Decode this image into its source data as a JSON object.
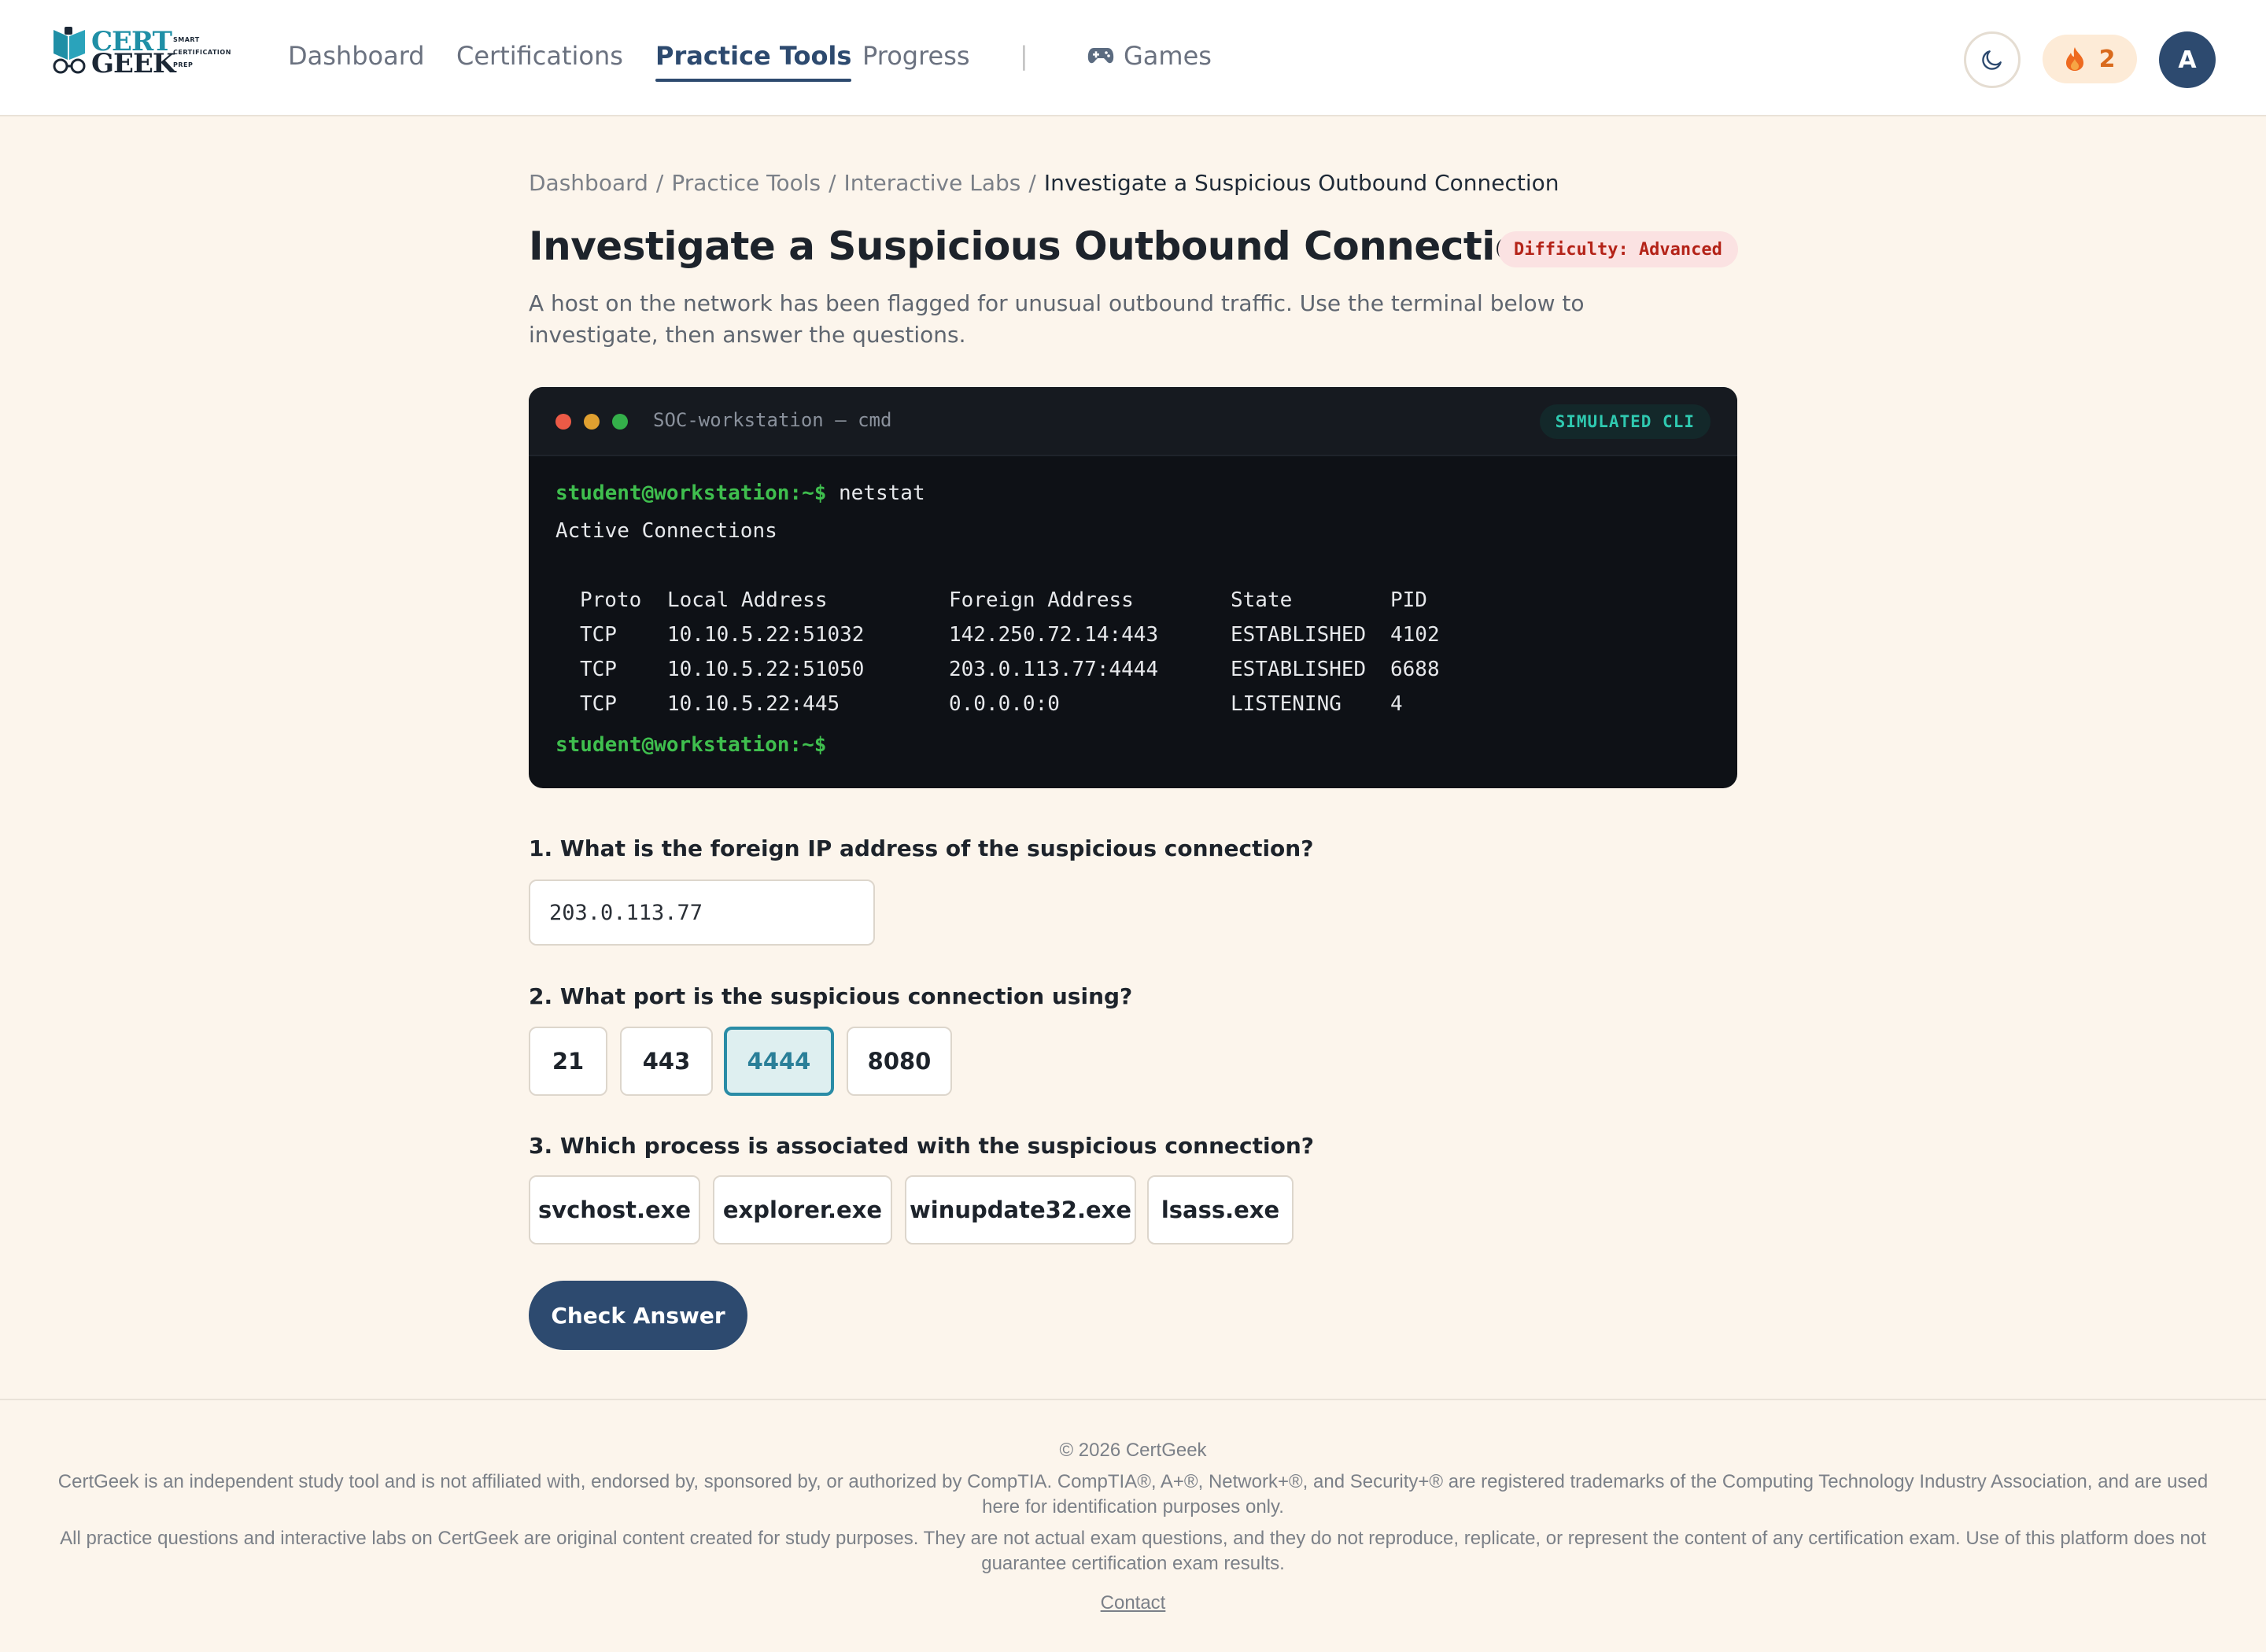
{
  "brand": {
    "word1": "CERT",
    "word2": "GEEK",
    "tag1": "SMART",
    "tag2": "CERTIFICATION",
    "tag3": "PREP"
  },
  "nav": {
    "items": [
      {
        "label": "Dashboard"
      },
      {
        "label": "Certifications"
      },
      {
        "label": "Practice Tools"
      },
      {
        "label": "Progress"
      }
    ],
    "separator": "|",
    "games_label": "Games",
    "games_icon": "gamepad-icon",
    "active": "Practice Tools"
  },
  "header": {
    "theme_icon": "moon-icon",
    "streak_icon": "flame-icon",
    "streak_count": "2",
    "avatar_initial": "A"
  },
  "breadcrumb": {
    "items": [
      "Dashboard",
      "Practice Tools",
      "Interactive Labs"
    ],
    "separator": "/",
    "current": "Investigate a Suspicious Outbound Connection"
  },
  "lab": {
    "title": "Investigate a Suspicious Outbound Connection",
    "difficulty": "Difficulty: Advanced",
    "description": "A host on the network has been flagged for unusual outbound traffic. Use the terminal below to investigate, then answer the questions."
  },
  "terminal": {
    "title": "SOC-workstation — cmd",
    "badge": "SIMULATED CLI",
    "prompt": "student@workstation:~$",
    "command": " netstat",
    "output_heading": "Active Connections",
    "columns": [
      "Proto",
      "Local Address",
      "Foreign Address",
      "State",
      "PID"
    ],
    "rows": [
      [
        "TCP",
        "10.10.5.22:51032",
        "142.250.72.14:443",
        "ESTABLISHED",
        "4102"
      ],
      [
        "TCP",
        "10.10.5.22:51050",
        "203.0.113.77:4444",
        "ESTABLISHED",
        "6688"
      ],
      [
        "TCP",
        "10.10.5.22:445",
        "0.0.0.0:0",
        "LISTENING",
        "4"
      ]
    ],
    "final_prompt": "student@workstation:~$"
  },
  "questions": {
    "q1": {
      "text": "1. What is the foreign IP address of the suspicious connection?",
      "value": "203.0.113.77"
    },
    "q2": {
      "text": "2. What port is the suspicious connection using?",
      "options": [
        "21",
        "443",
        "4444",
        "8080"
      ],
      "selected": "4444"
    },
    "q3": {
      "text": "3. Which process is associated with the suspicious connection?",
      "options": [
        "svchost.exe",
        "explorer.exe",
        "winupdate32.exe",
        "lsass.exe"
      ],
      "selected": ""
    },
    "submit_label": "Check Answer"
  },
  "footer": {
    "copyright": "© 2026 CertGeek",
    "disclaimer1": "CertGeek is an independent study tool and is not affiliated with, endorsed by, sponsored by, or authorized by CompTIA. CompTIA®, A+®, Network+®, and Security+® are registered trademarks of the Computing Technology Industry Association, and are used here for identification purposes only.",
    "disclaimer2": "All practice questions and interactive labs on CertGeek are original content created for study purposes. They are not actual exam questions, and they do not reproduce, replicate, or represent the content of any certification exam. Use of this platform does not guarantee certification exam results.",
    "contact": "Contact"
  },
  "colors": {
    "background": "#fcf5ec",
    "primary": "#2d4a6f",
    "accent": "#2a8ca6",
    "terminal_bg": "#0e1116",
    "prompt_green": "#3fbf4e",
    "danger": "#b42318"
  }
}
